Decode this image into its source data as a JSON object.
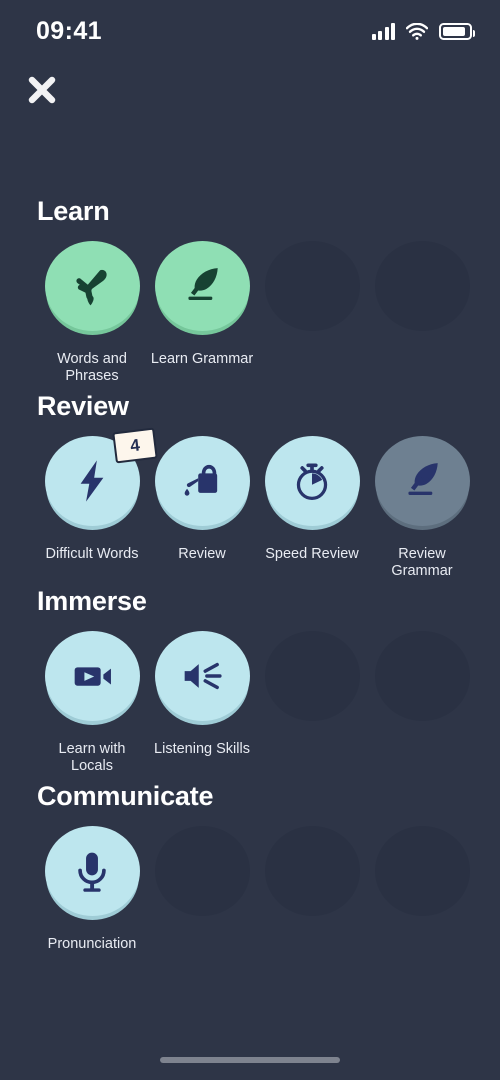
{
  "status_bar": {
    "time": "09:41",
    "signal_icon": "cellular-signal-icon",
    "wifi_icon": "wifi-icon",
    "battery_icon": "battery-icon"
  },
  "close_button": {
    "icon": "close-icon",
    "label": "Close"
  },
  "colors": {
    "background": "#2e3547",
    "empty_tile": "#2a3143",
    "green_tile": "#8fdfb4",
    "green_tile_shadow": "#76c79b",
    "blue_tile": "#bde6ee",
    "blue_tile_shadow": "#9fccd6",
    "disabled_tile": "#6e8091",
    "icon_green_dark": "#174232",
    "icon_navy": "#28346b",
    "label_text": "#e8ebf2",
    "badge_background": "#fdf6ec",
    "badge_text": "#253055"
  },
  "sections": [
    {
      "title": "Learn",
      "tiles": [
        {
          "label": "Words and Phrases",
          "icon": "hand-pinch-icon",
          "style": "green",
          "enabled": true
        },
        {
          "label": "Learn Grammar",
          "icon": "quill-pen-icon",
          "style": "green",
          "enabled": true
        },
        {
          "label": "",
          "icon": "empty-slot",
          "style": "empty",
          "enabled": false
        },
        {
          "label": "",
          "icon": "empty-slot",
          "style": "empty",
          "enabled": false
        }
      ]
    },
    {
      "title": "Review",
      "tiles": [
        {
          "label": "Difficult Words",
          "icon": "lightning-bolt-icon",
          "style": "blue",
          "enabled": true,
          "badge": "4"
        },
        {
          "label": "Review",
          "icon": "watering-can-icon",
          "style": "blue",
          "enabled": true
        },
        {
          "label": "Speed Review",
          "icon": "stopwatch-icon",
          "style": "blue",
          "enabled": true
        },
        {
          "label": "Review Grammar",
          "icon": "quill-pen-icon",
          "style": "grey",
          "enabled": false
        }
      ]
    },
    {
      "title": "Immerse",
      "tiles": [
        {
          "label": "Learn with Locals",
          "icon": "video-camera-icon",
          "style": "blue",
          "enabled": true
        },
        {
          "label": "Listening Skills",
          "icon": "speaker-sound-icon",
          "style": "blue",
          "enabled": true
        },
        {
          "label": "",
          "icon": "empty-slot",
          "style": "empty",
          "enabled": false
        },
        {
          "label": "",
          "icon": "empty-slot",
          "style": "empty",
          "enabled": false
        }
      ]
    },
    {
      "title": "Communicate",
      "tiles": [
        {
          "label": "Pronunciation",
          "icon": "microphone-icon",
          "style": "blue",
          "enabled": true
        },
        {
          "label": "",
          "icon": "empty-slot",
          "style": "empty",
          "enabled": false
        },
        {
          "label": "",
          "icon": "empty-slot",
          "style": "empty",
          "enabled": false
        },
        {
          "label": "",
          "icon": "empty-slot",
          "style": "empty",
          "enabled": false
        }
      ]
    }
  ],
  "home_indicator": "home-indicator"
}
